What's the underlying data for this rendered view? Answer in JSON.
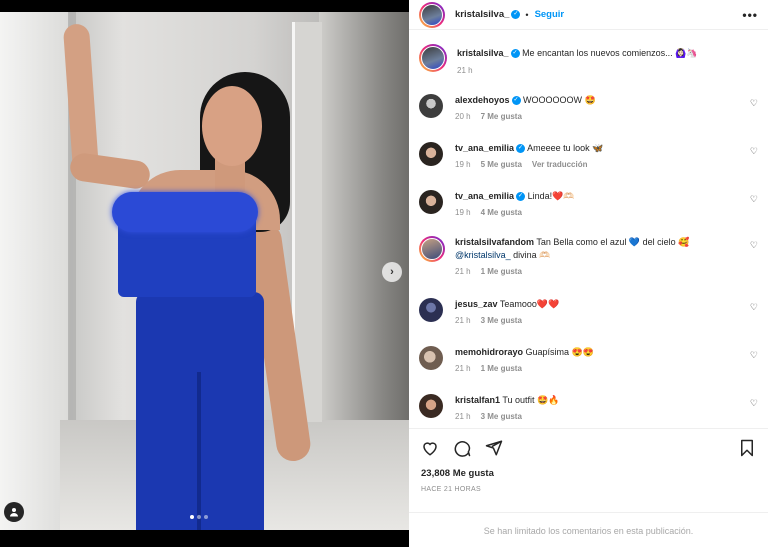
{
  "post": {
    "author": "kristalsilva_",
    "follow_label": "Seguir",
    "separator": "•",
    "caption": "Me encantan los nuevos comienzos... 🙆🏻‍♀️🦄",
    "caption_time": "21 h",
    "carousel": {
      "slides": 3,
      "active_index": 0
    }
  },
  "comments": [
    {
      "user": "alexdehoyos",
      "verified": true,
      "text": "WOOOOOOW 🤩",
      "time": "20 h",
      "likes": "7 Me gusta",
      "extra": ""
    },
    {
      "user": "tv_ana_emilia",
      "verified": true,
      "text": "Ameeee tu look 🦋",
      "time": "19 h",
      "likes": "5 Me gusta",
      "extra": "Ver traducción"
    },
    {
      "user": "tv_ana_emilia",
      "verified": true,
      "text": "Linda!❤️🫶🏻",
      "time": "19 h",
      "likes": "4 Me gusta",
      "extra": ""
    },
    {
      "user": "kristalsilvafandom",
      "verified": false,
      "text": "Tan Bella como el azul 💙 del cielo 🥰",
      "mention": "@kristalsilva_",
      "text2": "divina 🫶🏻",
      "time": "21 h",
      "likes": "1 Me gusta",
      "extra": ""
    },
    {
      "user": "jesus_zav",
      "verified": false,
      "text": "Teamooo❤️❤️",
      "time": "21 h",
      "likes": "3 Me gusta",
      "extra": ""
    },
    {
      "user": "memohidrorayo",
      "verified": false,
      "text": "Guapísima 😍😍",
      "time": "21 h",
      "likes": "1 Me gusta",
      "extra": ""
    },
    {
      "user": "kristalfan1",
      "verified": false,
      "text": "Tu outfit 🤩🔥",
      "time": "21 h",
      "likes": "3 Me gusta",
      "extra": ""
    }
  ],
  "stats": {
    "likes": "23,808 Me gusta",
    "posted_ago": "HACE 21 HORAS"
  },
  "footer": {
    "limited_comments": "Se han limitado los comentarios en esta publicación."
  },
  "colors": {
    "accent": "#0095f6",
    "jumpsuit": "#1f3fbf",
    "muted": "#8e8e8e"
  },
  "icons": [
    "chevron-right-icon",
    "user-tag-icon",
    "more-icon",
    "heart-icon",
    "comment-icon",
    "share-icon",
    "save-icon",
    "verified-icon"
  ]
}
